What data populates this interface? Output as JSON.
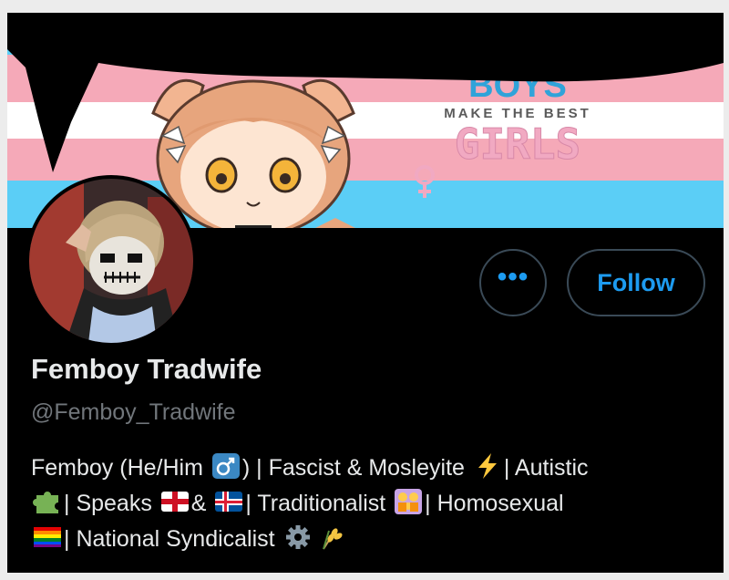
{
  "banner": {
    "art_line1": "BOYS",
    "art_line2": "MAKE THE BEST",
    "art_line3": "GIRLS"
  },
  "actions": {
    "more_label": "•••",
    "follow_label": "Follow"
  },
  "profile": {
    "display_name": "Femboy Tradwife",
    "handle": "@Femboy_Tradwife"
  },
  "bio": {
    "line1_a": "Femboy (He/Him",
    "line1_b": ") | Fascist & Mosleyite",
    "line1_c": "| Autistic",
    "line2_a": "| Speaks",
    "line2_b": "&",
    "line2_c": "| Traditionalist",
    "line2_d": "| Homosexual",
    "line3_a": "| National Syndicalist"
  },
  "colors": {
    "accent": "#1d9bf0",
    "background": "#000000",
    "text_primary": "#e7e9ea",
    "text_secondary": "#71767b",
    "trans_blue": "#5bcef6",
    "trans_pink": "#f5a9b8"
  },
  "icons": [
    "more-icon",
    "male-sign-emoji",
    "lightning-emoji",
    "puzzle-emoji",
    "england-flag-emoji",
    "iceland-flag-emoji",
    "family-emoji",
    "rainbow-flag-emoji",
    "gear-emoji",
    "wheat-emoji"
  ]
}
